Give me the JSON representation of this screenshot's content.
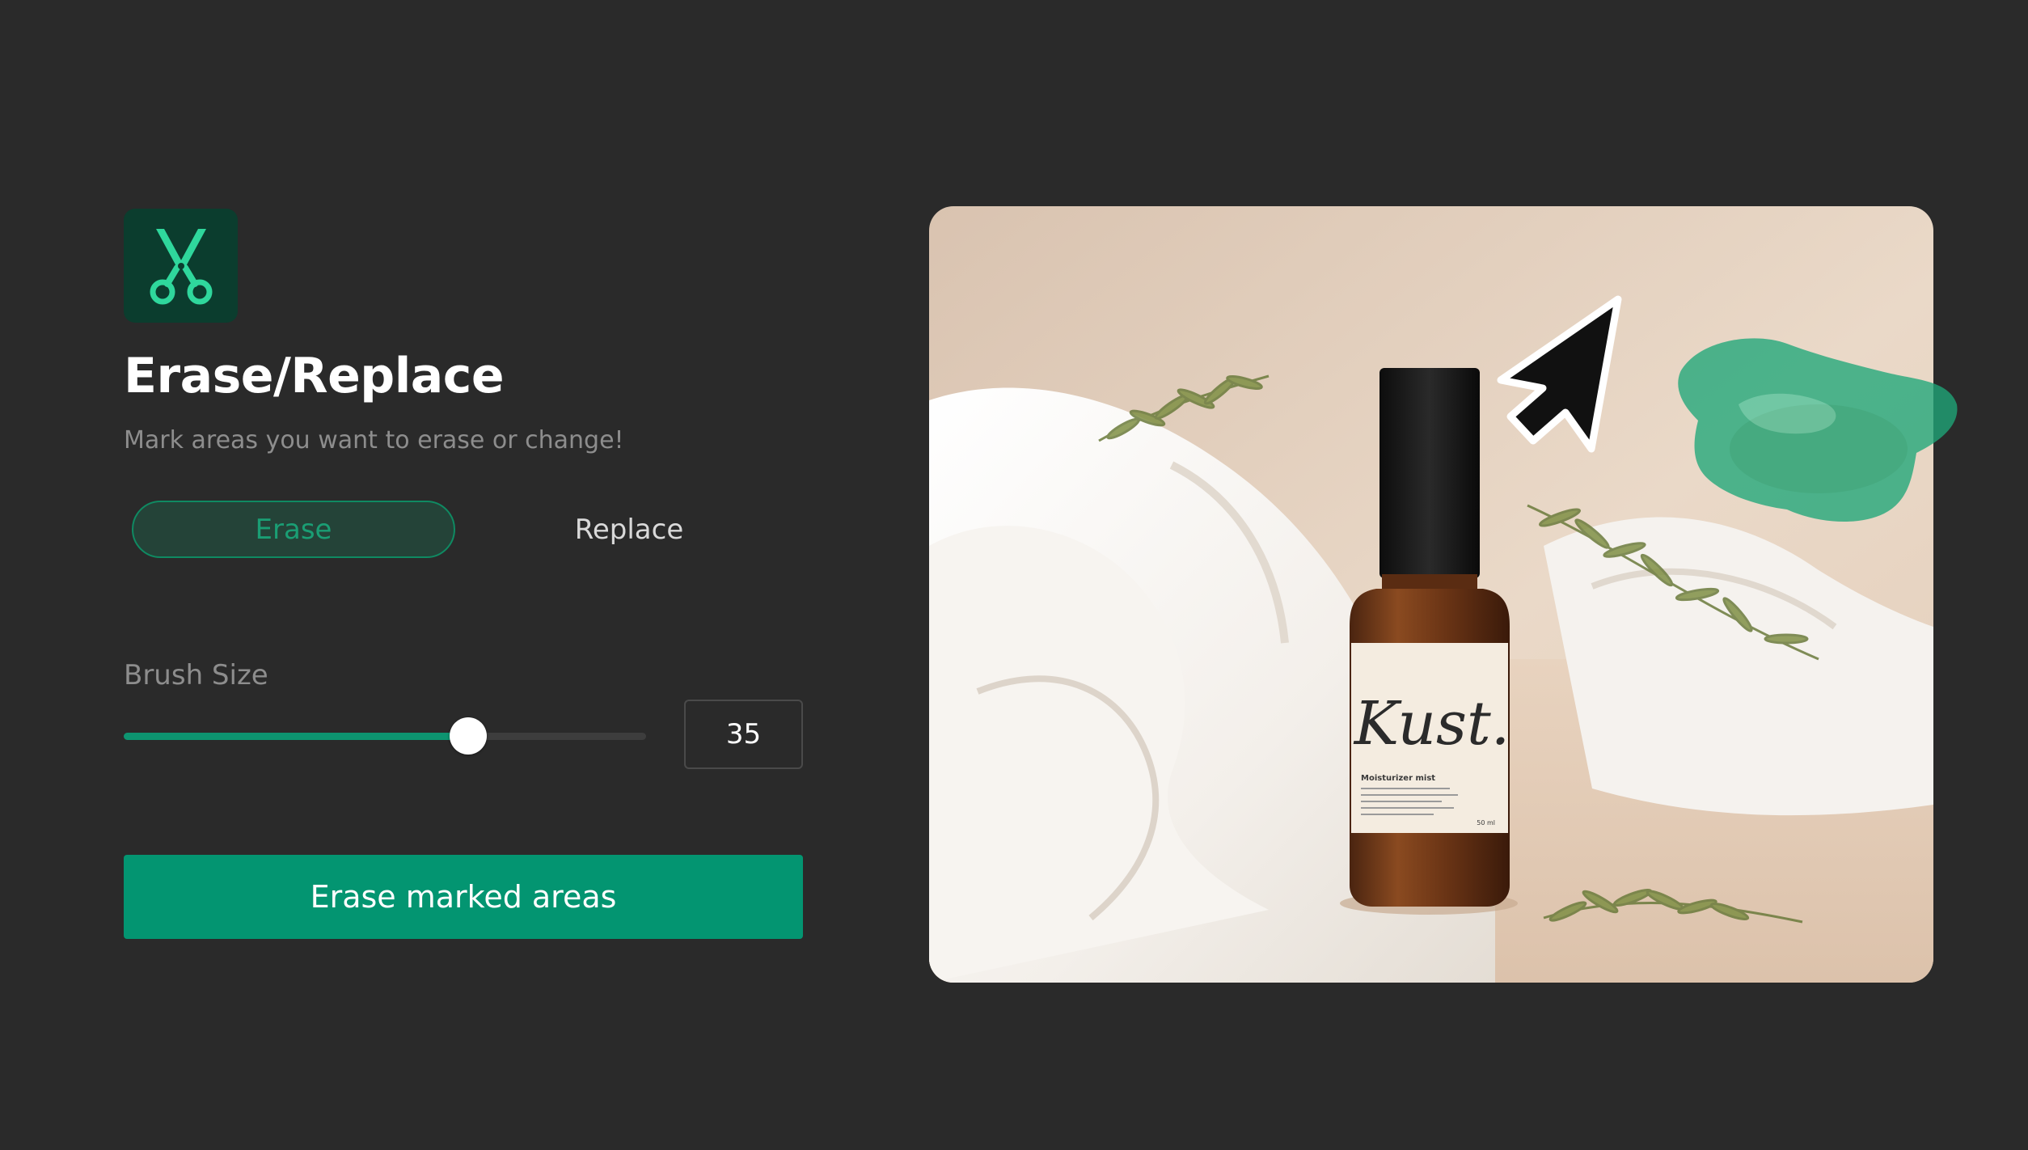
{
  "panel": {
    "icon": "scissors-icon",
    "title": "Erase/Replace",
    "subtitle": "Mark areas you want to erase or change!",
    "modes": {
      "erase_label": "Erase",
      "replace_label": "Replace",
      "selected": "Erase"
    },
    "brush": {
      "label": "Brush Size",
      "value": "35",
      "fraction": 0.66
    },
    "action_label": "Erase marked areas"
  },
  "canvas": {
    "product": {
      "brand": "Kust.",
      "name": "Moisturizer mist",
      "volume": "50 ml"
    },
    "cursor_icon": "arrow-cursor-icon",
    "mark_color": "#1fa779"
  },
  "colors": {
    "background": "#2a2a2a",
    "accent": "#039571",
    "accent_text": "#1a9e74",
    "toggle_bg": "#244338",
    "icon_bg": "#0b3d2e"
  }
}
